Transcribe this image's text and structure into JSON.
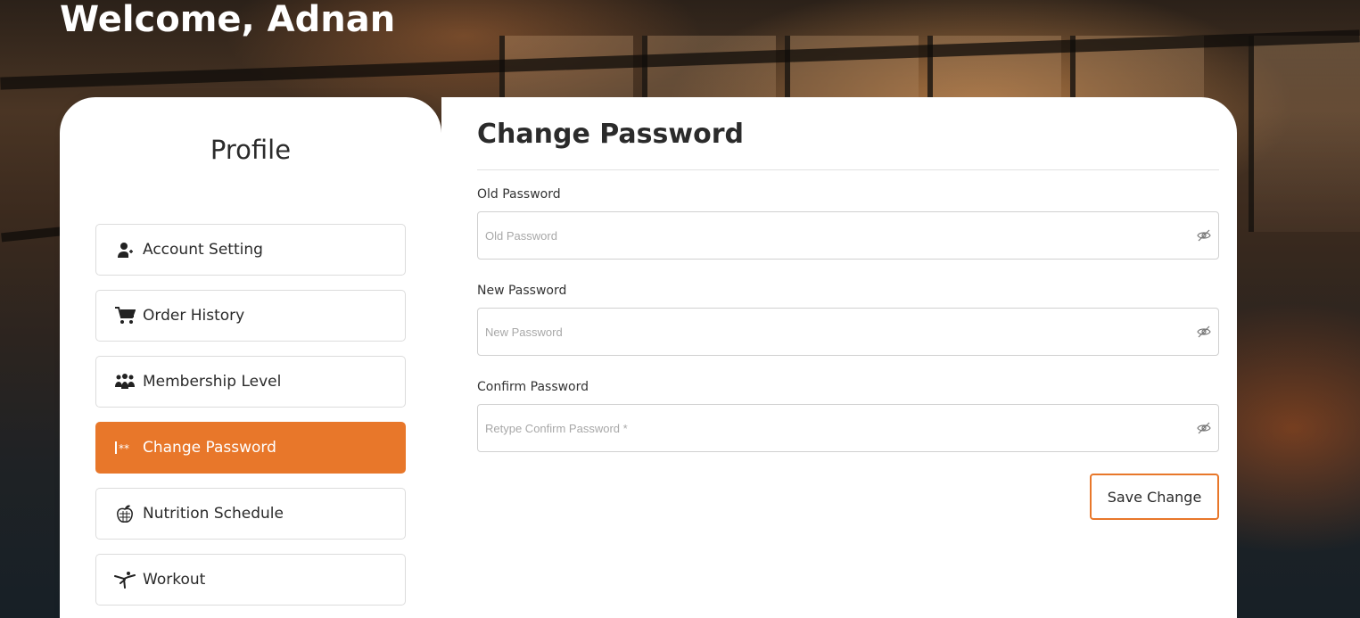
{
  "header": {
    "welcome": "Welcome, Adnan"
  },
  "sidebar": {
    "title": "Profile",
    "items": [
      {
        "label": "Account Setting",
        "icon": "user-plus-icon"
      },
      {
        "label": "Order History",
        "icon": "cart-icon"
      },
      {
        "label": "Membership Level",
        "icon": "group-icon"
      },
      {
        "label": "Change Password",
        "icon": "password-icon",
        "active": true
      },
      {
        "label": "Nutrition Schedule",
        "icon": "apple-icon"
      },
      {
        "label": "Workout",
        "icon": "workout-icon"
      }
    ]
  },
  "form": {
    "title": "Change Password",
    "old": {
      "label": "Old Password",
      "placeholder": "Old Password"
    },
    "new": {
      "label": "New Password",
      "placeholder": "New Password"
    },
    "confirm": {
      "label": "Confirm Password",
      "placeholder": "Retype Confirm Password *"
    },
    "save_label": "Save Change"
  },
  "colors": {
    "accent": "#e8772a"
  }
}
